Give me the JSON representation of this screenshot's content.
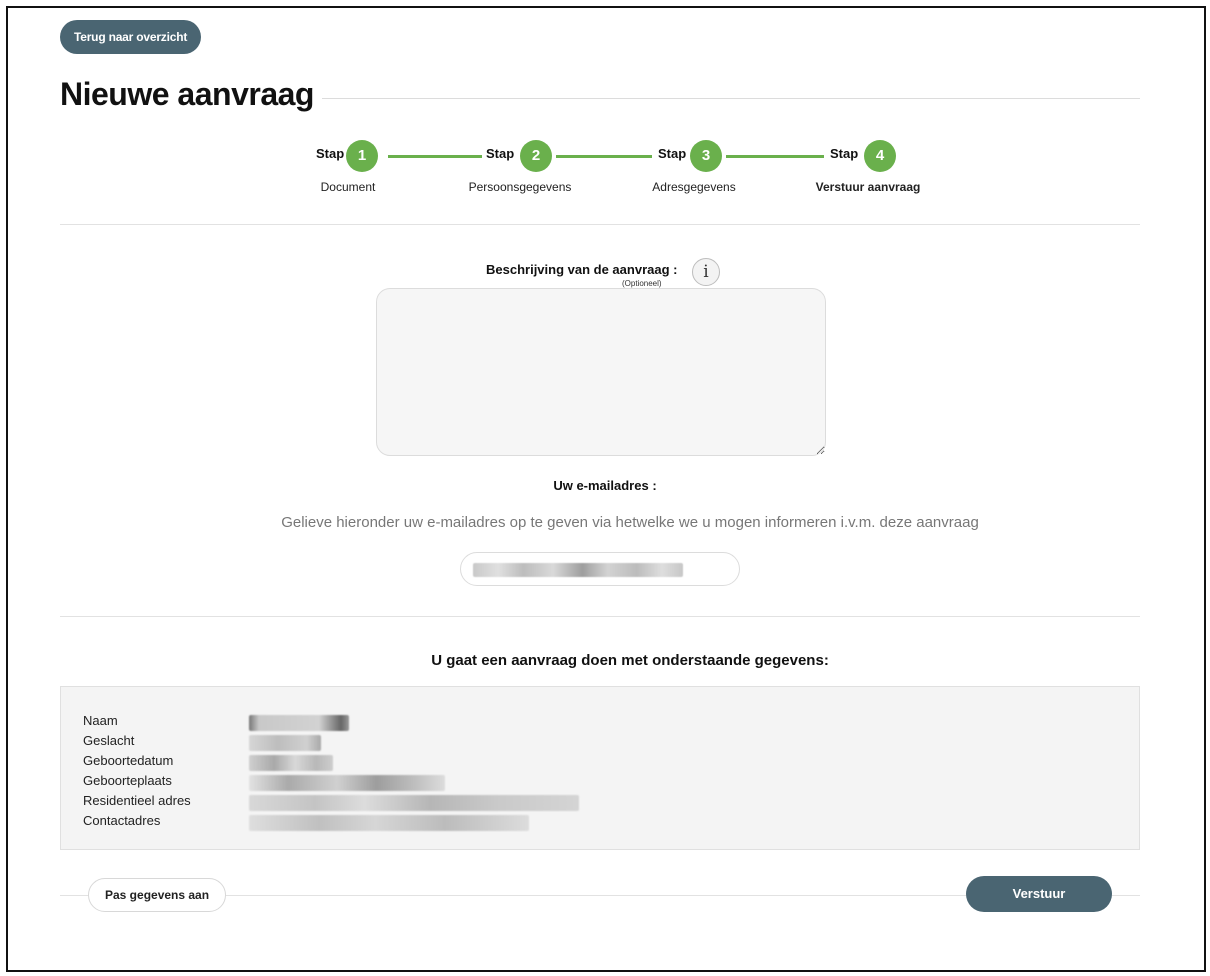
{
  "nav": {
    "back_label": "Terug naar overzicht"
  },
  "page": {
    "title": "Nieuwe aanvraag"
  },
  "stepper": {
    "stap_word": "Stap",
    "steps": [
      {
        "number": "1",
        "caption": "Document",
        "state": "completed"
      },
      {
        "number": "2",
        "caption": "Persoonsgegevens",
        "state": "completed"
      },
      {
        "number": "3",
        "caption": "Adresgegevens",
        "state": "completed"
      },
      {
        "number": "4",
        "caption": "Verstuur aanvraag",
        "state": "current"
      }
    ],
    "accent_color": "#6ab04c"
  },
  "description": {
    "label": "Beschrijving van de aanvraag :",
    "optional": "(Optioneel)",
    "info_icon": "info-icon",
    "value": ""
  },
  "email": {
    "label": "Uw e-mailadres :",
    "help": "Gelieve hieronder uw e-mailadres op te geven via hetwelke we u mogen informeren i.v.m. deze aanvraag",
    "value_redacted": true
  },
  "summary": {
    "title": "U gaat een aanvraag doen met onderstaande gegevens:",
    "rows": [
      {
        "label": "Naam",
        "value_redacted": true
      },
      {
        "label": "Geslacht",
        "value_redacted": true
      },
      {
        "label": "Geboortedatum",
        "value_redacted": true
      },
      {
        "label": "Geboorteplaats",
        "value_redacted": true
      },
      {
        "label": "Residentieel adres",
        "value_redacted": true
      },
      {
        "label": "Contactadres",
        "value_redacted": true
      }
    ]
  },
  "actions": {
    "edit_label": "Pas gegevens aan",
    "submit_label": "Verstuur",
    "primary_color": "#4a6572"
  }
}
